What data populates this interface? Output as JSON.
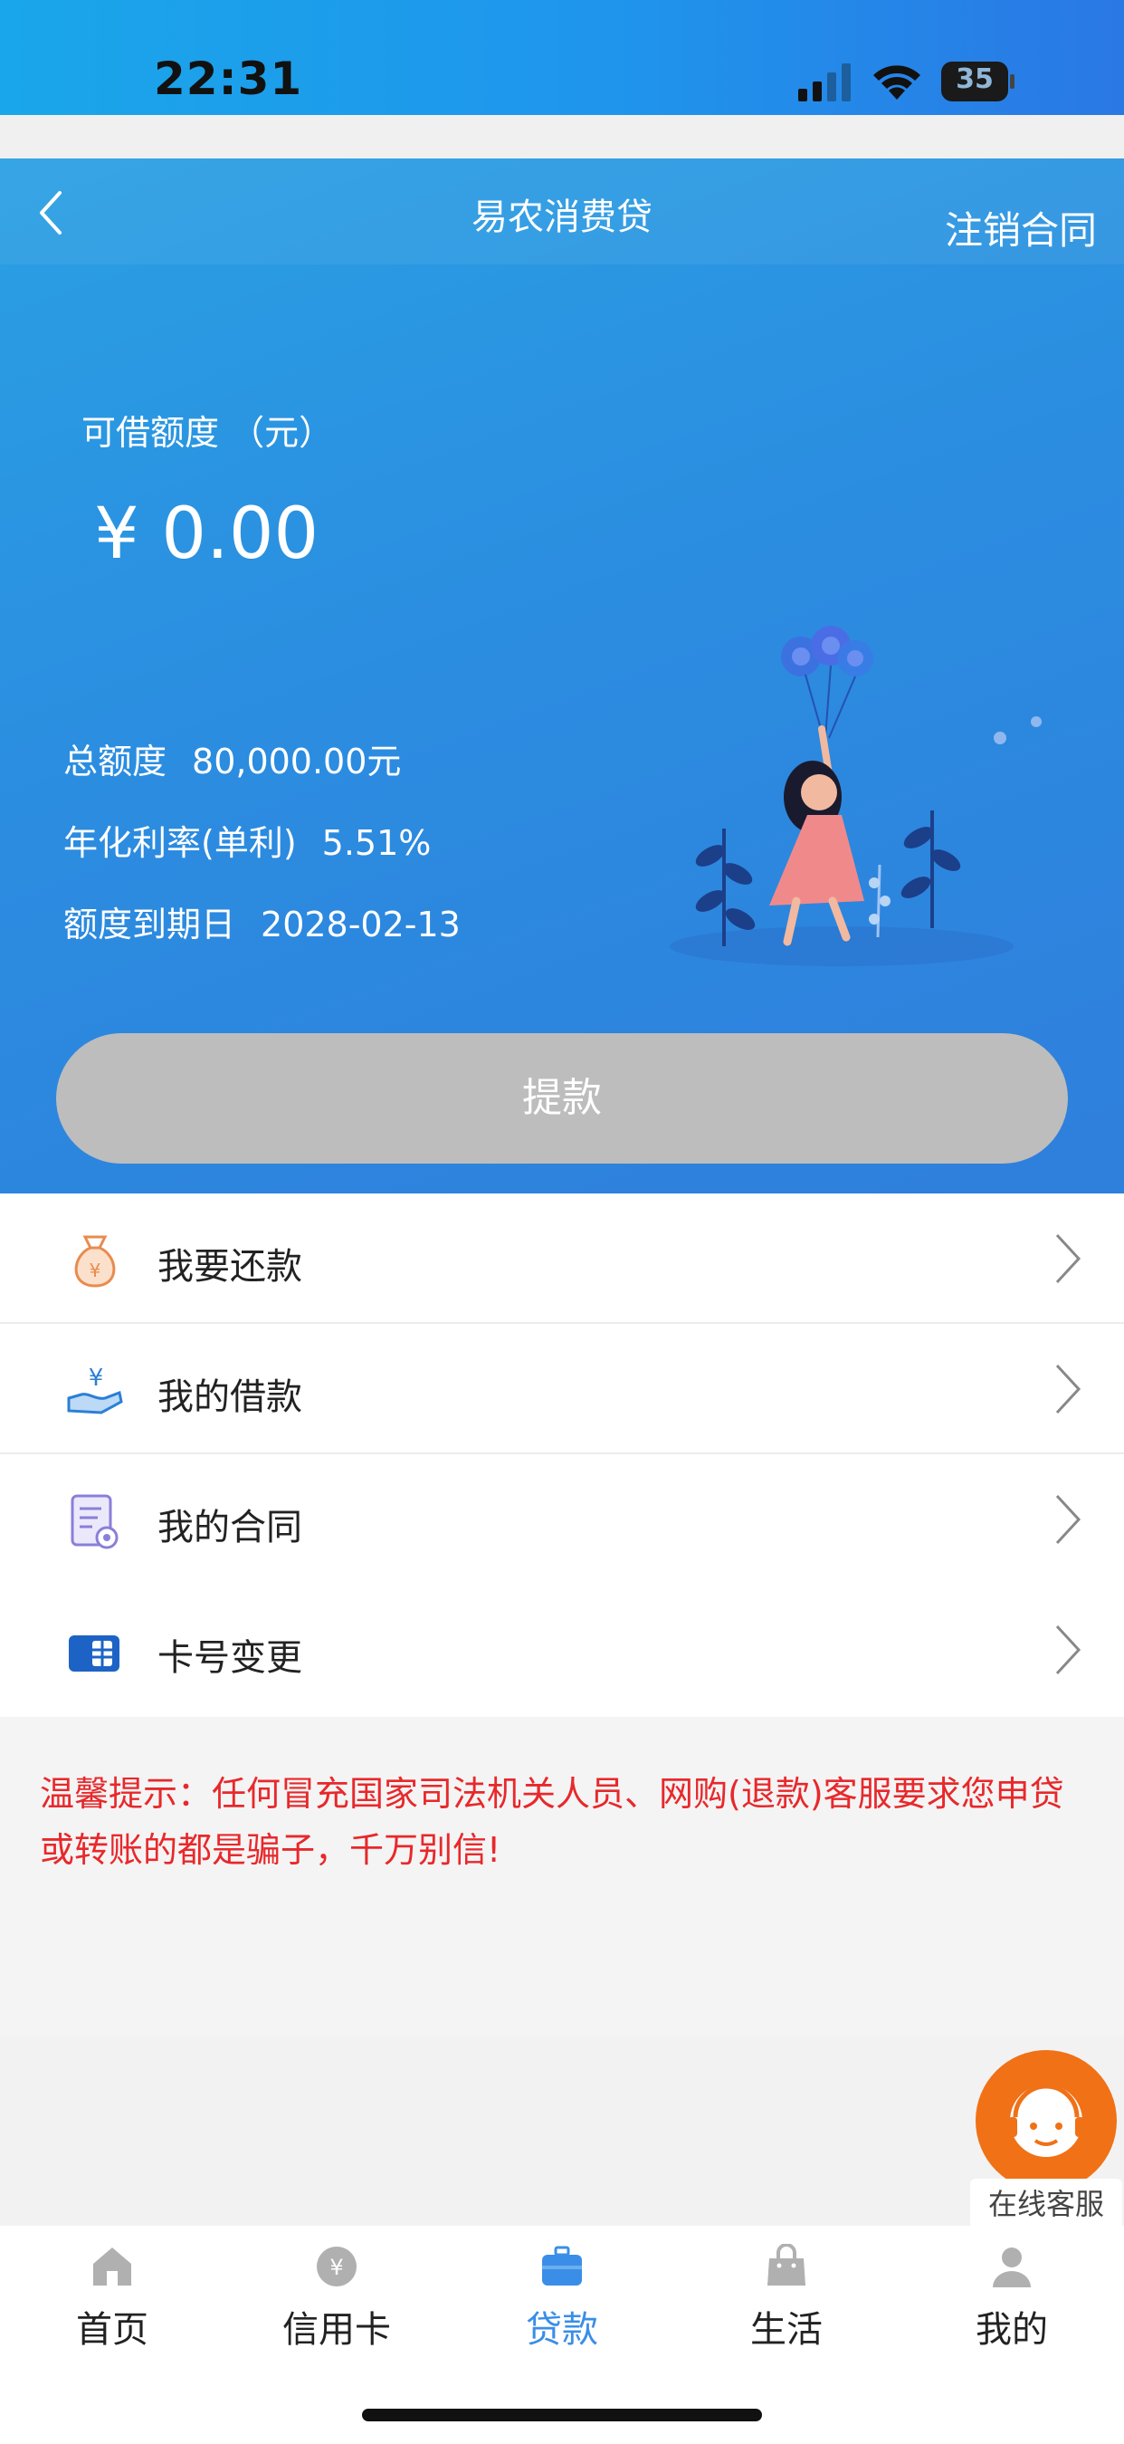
{
  "status_bar": {
    "time": "22:31",
    "battery": "35"
  },
  "nav": {
    "title": "易农消费贷",
    "action": "注销合同"
  },
  "credit": {
    "available_label": "可借额度 （元）",
    "available_amount": "¥ 0.00",
    "total_label": "总额度",
    "total_value": "80,000.00元",
    "rate_label": "年化利率(单利)",
    "rate_value": "5.51%",
    "expire_label": "额度到期日",
    "expire_value": "2028-02-13"
  },
  "withdraw_button": "提款",
  "menu": [
    {
      "label": "我要还款",
      "icon": "money-bag-icon"
    },
    {
      "label": "我的借款",
      "icon": "hand-yuan-icon"
    },
    {
      "label": "我的合同",
      "icon": "contract-icon"
    },
    {
      "label": "卡号变更",
      "icon": "bank-card-icon"
    }
  ],
  "notice": "温馨提示：任何冒充国家司法机关人员、网购(退款)客服要求您申贷或转账的都是骗子，千万别信!",
  "customer_service": "在线客服",
  "tabs": [
    {
      "label": "首页",
      "icon": "home-icon"
    },
    {
      "label": "信用卡",
      "icon": "yuan-coin-icon"
    },
    {
      "label": "贷款",
      "icon": "briefcase-icon"
    },
    {
      "label": "生活",
      "icon": "shopping-bag-icon"
    },
    {
      "label": "我的",
      "icon": "user-icon"
    }
  ],
  "colors": {
    "accent": "#3a8ee8",
    "notice": "#e8282b",
    "service": "#f07116",
    "button_disabled": "#bdbdbd"
  }
}
